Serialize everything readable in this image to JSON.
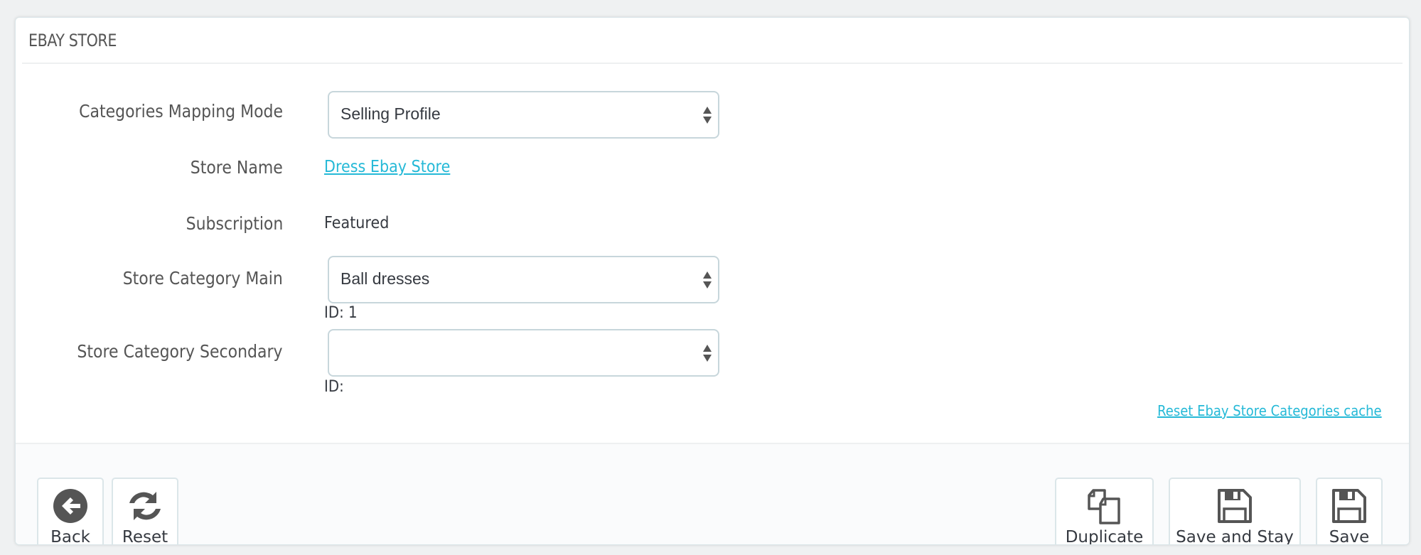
{
  "panel": {
    "title": "EBAY STORE"
  },
  "form": {
    "mapping_mode": {
      "label": "Categories Mapping Mode",
      "selected": "Selling Profile"
    },
    "store_name": {
      "label": "Store Name",
      "value": "Dress Ebay Store"
    },
    "subscription": {
      "label": "Subscription",
      "value": "Featured"
    },
    "category_main": {
      "label": "Store Category Main",
      "selected": "Ball dresses",
      "id_text": "ID: 1"
    },
    "category_secondary": {
      "label": "Store Category Secondary",
      "selected": "",
      "id_text": "ID:"
    },
    "reset_cache_link": "Reset Ebay Store Categories cache"
  },
  "footer": {
    "back": {
      "label": "Back",
      "icon": "arrow-circle-left-icon"
    },
    "reset": {
      "label": "Reset",
      "icon": "refresh-icon"
    },
    "duplicate": {
      "label": "Duplicate",
      "icon": "copy-icon"
    },
    "save_and_stay": {
      "label": "Save and Stay",
      "icon": "floppy-disk-icon"
    },
    "save": {
      "label": "Save",
      "icon": "floppy-disk-icon"
    }
  },
  "colors": {
    "link": "#25b9d7",
    "background": "#eff1f2",
    "text": "#363a41"
  }
}
